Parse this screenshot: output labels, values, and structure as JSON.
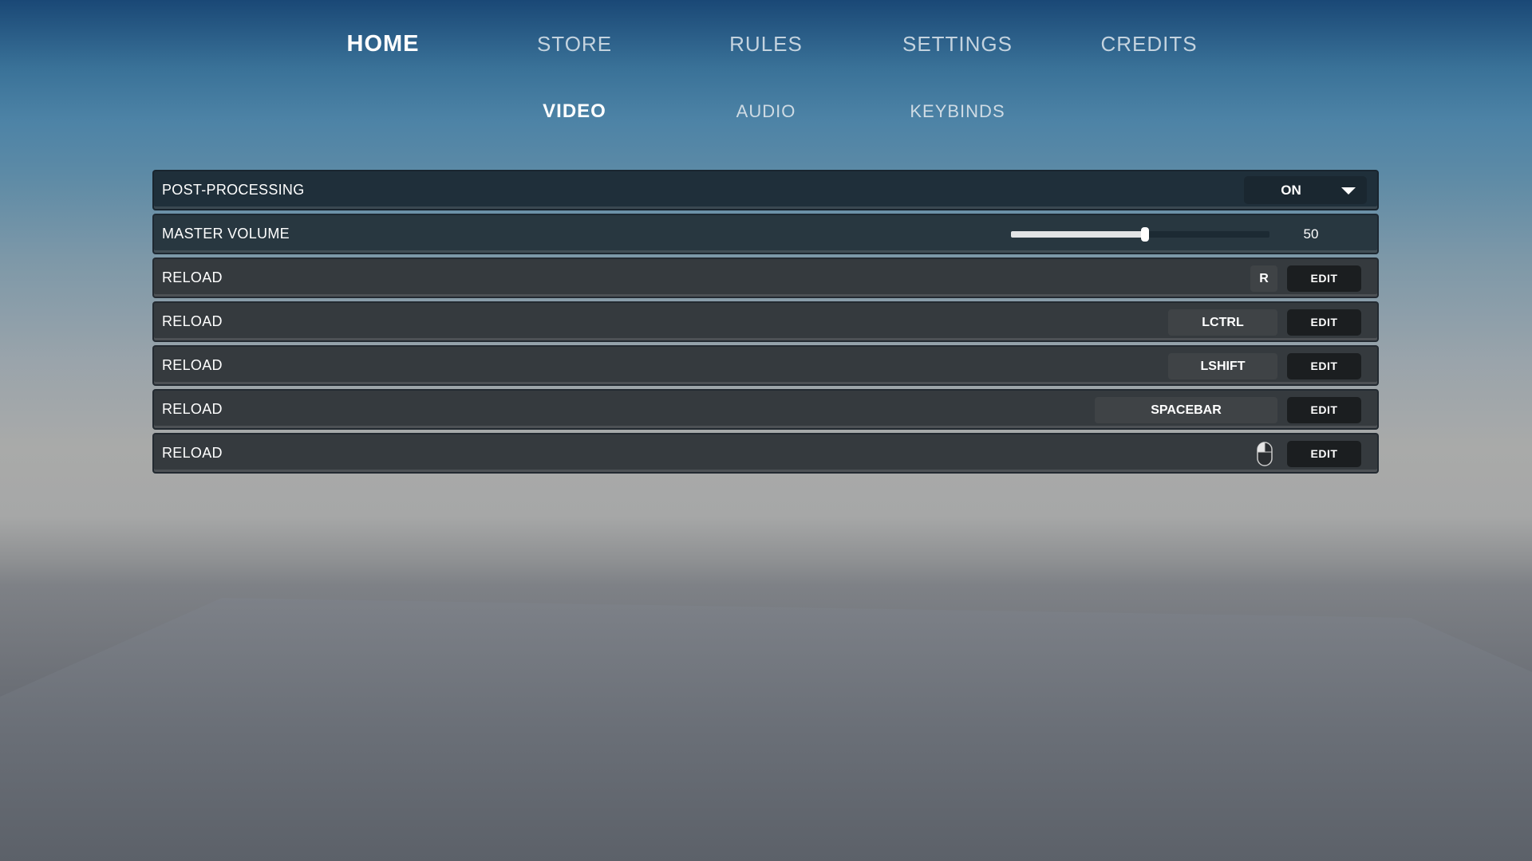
{
  "nav": {
    "tabs": [
      {
        "label": "HOME",
        "active": true
      },
      {
        "label": "STORE",
        "active": false
      },
      {
        "label": "RULES",
        "active": false
      },
      {
        "label": "SETTINGS",
        "active": false
      },
      {
        "label": "CREDITS",
        "active": false
      }
    ]
  },
  "subnav": {
    "tabs": [
      {
        "label": "VIDEO",
        "active": true
      },
      {
        "label": "AUDIO",
        "active": false
      },
      {
        "label": "KEYBINDS",
        "active": false
      }
    ]
  },
  "settings": {
    "post_processing": {
      "label": "POST-PROCESSING",
      "value": "ON"
    },
    "master_volume": {
      "label": "MASTER VOLUME",
      "value": "50",
      "fraction": 0.52
    },
    "keybinds": [
      {
        "label": "RELOAD",
        "key": "R",
        "edit_label": "EDIT"
      },
      {
        "label": "RELOAD",
        "key": "LCTRL",
        "edit_label": "EDIT"
      },
      {
        "label": "RELOAD",
        "key": "LSHIFT",
        "edit_label": "EDIT"
      },
      {
        "label": "RELOAD",
        "key": "SPACEBAR",
        "edit_label": "EDIT"
      },
      {
        "label": "RELOAD",
        "key": "",
        "key_icon": "mouse-left-click-icon",
        "edit_label": "EDIT"
      }
    ]
  }
}
